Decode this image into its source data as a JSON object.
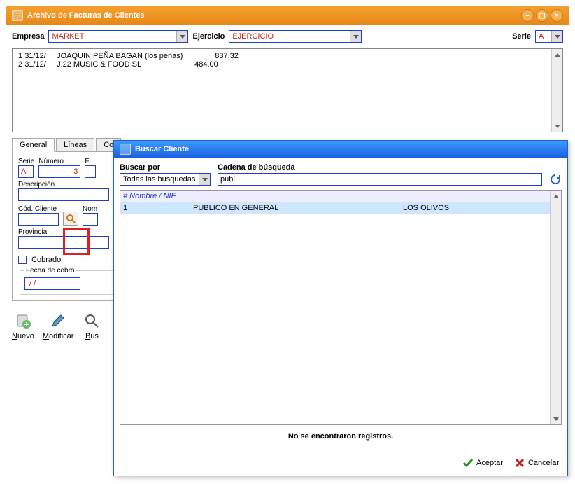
{
  "main": {
    "title": "Archivo de Facturas de Clientes",
    "filters": {
      "empresa_label": "Empresa",
      "empresa_value": "MARKET",
      "ejercicio_label": "Ejercicio",
      "ejercicio_value": "EJERCICIO",
      "serie_label": "Serie",
      "serie_value": "A"
    },
    "list": [
      {
        "n": "1",
        "date": "31/12/",
        "desc": "JOAQUIN PEÑA BAGAN (los peñas)",
        "amount": "837,32"
      },
      {
        "n": "2",
        "date": "31/12/",
        "desc": "J.22 MUSIC & FOOD SL",
        "amount": "484,00"
      }
    ],
    "tabs": {
      "general_u": "G",
      "general_rest": "eneral",
      "lineas_u": "L",
      "lineas_rest": "íneas",
      "co_label": "Co"
    },
    "form": {
      "serie_label": "Serie",
      "serie_value": "A",
      "numero_label": "Número",
      "numero_value": "3",
      "f_label": "F.",
      "descripcion_label": "Descripción",
      "cod_cliente_label": "Cód. Cliente",
      "nom_label": "Nom",
      "provincia_label": "Provincia",
      "cobrado_label": "Cobrado",
      "fecha_cobro_label": "Fecha de cobro",
      "fecha_cobro_value": " / /"
    },
    "toolbar": {
      "nuevo_u": "N",
      "nuevo_rest": "uevo",
      "modificar_u": "M",
      "modificar_rest": "odificar",
      "bus_u": "B",
      "bus_rest": "us"
    }
  },
  "dialog": {
    "title": "Buscar Cliente",
    "buscar_por_label": "Buscar por",
    "buscar_por_value": "Todas las busquedas",
    "cadena_label": "Cadena de búsqueda",
    "cadena_value": "publ",
    "grid_head": "# Nombre / NIF",
    "row": {
      "n": "1",
      "name": "PUBLICO EN GENERAL",
      "extra": "LOS OLIVOS"
    },
    "status": "No se encontraron registros.",
    "aceptar_u": "A",
    "aceptar_rest": "ceptar",
    "cancelar_u": "C",
    "cancelar_rest": "ancelar"
  }
}
